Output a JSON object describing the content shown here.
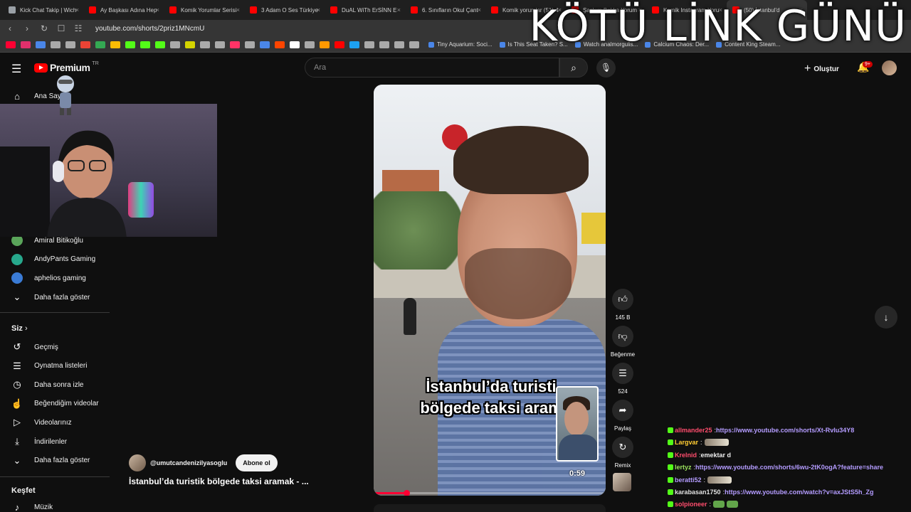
{
  "browser": {
    "tabs": [
      {
        "label": "Kick Chat Takip | Wich",
        "color": "#9aa0a6",
        "active": false
      },
      {
        "label": "Ay Başkası Adına Hep",
        "color": "#ff0000",
        "active": false
      },
      {
        "label": "Komik Yorumlar Serisi",
        "color": "#ff0000",
        "active": false
      },
      {
        "label": "3 Adam O Ses Türkiye",
        "color": "#ff0000",
        "active": false
      },
      {
        "label": "DuAL WiTh ErSİNN E",
        "color": "#ff0000",
        "active": false
      },
      {
        "label": "6. Sınıfların Okul Çant",
        "color": "#ff0000",
        "active": false
      },
      {
        "label": "Komik yorumlar (51) 4",
        "color": "#ff0000",
        "active": false
      },
      {
        "label": "Şaşkım Bakka Yorum",
        "color": "#ff0000",
        "active": false
      },
      {
        "label": "Komik Instagram Yoru",
        "color": "#ff0000",
        "active": false
      },
      {
        "label": "(50) İstanbul'd",
        "color": "#ff0000",
        "active": true
      }
    ],
    "url": "youtube.com/shorts/2priz1MNcmU",
    "bookmark_icon_colors": [
      "#ff0033",
      "#e1306c",
      "#4a86e8",
      "#aaa",
      "#aaa",
      "#ea4335",
      "#34a853",
      "#fbbc05",
      "#53fc18",
      "#53fc18",
      "#53fc18",
      "#aaa",
      "#d4d400",
      "#aaa",
      "#aaa",
      "#ff3366",
      "#aaa",
      "#4a86e8",
      "#ff4500",
      "#fff",
      "#aaa",
      "#ff9900",
      "#ff0000",
      "#1da1f2",
      "#aaa",
      "#aaa",
      "#aaa",
      "#aaa"
    ],
    "bookmarks": [
      "Tiny Aquarium: Soci...",
      "Is This Seat Taken? S...",
      "Watch analmorgulis...",
      "Calcium Chaos: Der...",
      "Content King Steam..."
    ]
  },
  "overlay": {
    "title": "KÖTÜ LİNK GÜNÜ"
  },
  "youtube": {
    "logo_text": "Premium",
    "logo_region": "TR",
    "search_placeholder": "Ara",
    "create_label": "Oluştur",
    "notification_count": "9+"
  },
  "sidebar": {
    "home_label": "Ana Sayfa",
    "subscriptions": [
      "Amiral Bitikoğlu",
      "AndyPants Gaming",
      "aphelios gaming"
    ],
    "subs_more": "Daha fazla göster",
    "you_header": "Siz",
    "you_items": [
      "Geçmiş",
      "Oynatma listeleri",
      "Daha sonra izle",
      "Beğendiğim videolar",
      "Videolarınız",
      "İndirilenler",
      "Daha fazla göster"
    ],
    "explore_header": "Keşfet",
    "explore_items": [
      "Müzik"
    ]
  },
  "video": {
    "caption_line1": "İstanbul’da turisti",
    "caption_line2": "bölgede taksi aram",
    "time": "0:59",
    "progress": 0.14,
    "channel": "@umutcandenizilyasoglu",
    "subscribe_label": "Abone ol",
    "title": "İstanbul’da turistik bölgede taksi aramak - ..."
  },
  "actions": {
    "like_count": "145 B",
    "dislike_label": "Beğenme",
    "comment_count": "524",
    "share_label": "Paylaş",
    "remix_label": "Remix"
  },
  "chat": [
    {
      "user": "allmander25",
      "user_color": "#ff4d6d",
      "sep": " : ",
      "text": "",
      "link": "https://www.youtube.com/shorts/Xt-RvIu34Y8",
      "emote": ""
    },
    {
      "user": "Largvar",
      "user_color": "#ffcc33",
      "sep": " : ",
      "text": "",
      "link": "",
      "emote": "gray"
    },
    {
      "user": "Krelnid",
      "user_color": "#ff4d6d",
      "sep": " : ",
      "text": "emektar d",
      "link": "",
      "emote": ""
    },
    {
      "user": "lertyz",
      "user_color": "#9be15d",
      "sep": " : ",
      "text": "",
      "link": "https://www.youtube.com/shorts/6wu-2tK0ogA?feature=share",
      "emote": ""
    },
    {
      "user": "beratti52",
      "user_color": "#b49cff",
      "sep": " : ",
      "text": "",
      "link": "",
      "emote": "gray"
    },
    {
      "user": "karabasan1750",
      "user_color": "#e0e0e0",
      "sep": " : ",
      "text": "",
      "link": "https://www.youtube.com/watch?v=axJStS5h_Zg",
      "emote": ""
    },
    {
      "user": "solpioneer",
      "user_color": "#ff4d6d",
      "sep": " : ",
      "text": "",
      "link": "",
      "emote": "green"
    }
  ]
}
